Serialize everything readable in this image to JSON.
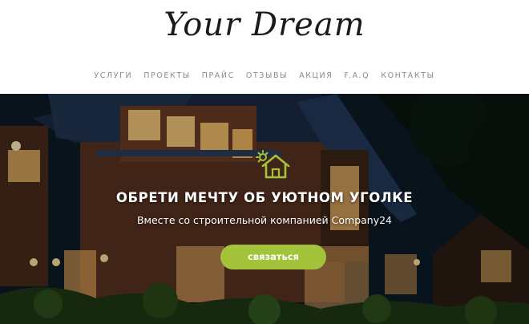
{
  "header": {
    "logo_text": "Your Dream",
    "nav": [
      "услуги",
      "проекты",
      "прайс",
      "отзывы",
      "акция",
      "F.A.Q",
      "контакты"
    ]
  },
  "hero": {
    "icon": "house-sun-icon",
    "headline": "ОБРЕТИ МЕЧТУ ОБ УЮТНОМ УГОЛКЕ",
    "subline": "Вместе со строительной компанией Company24",
    "cta_label": "связаться"
  },
  "colors": {
    "accent": "#a3c43a",
    "nav_text": "#8a8a8a",
    "logo_text": "#1a1a1a"
  }
}
